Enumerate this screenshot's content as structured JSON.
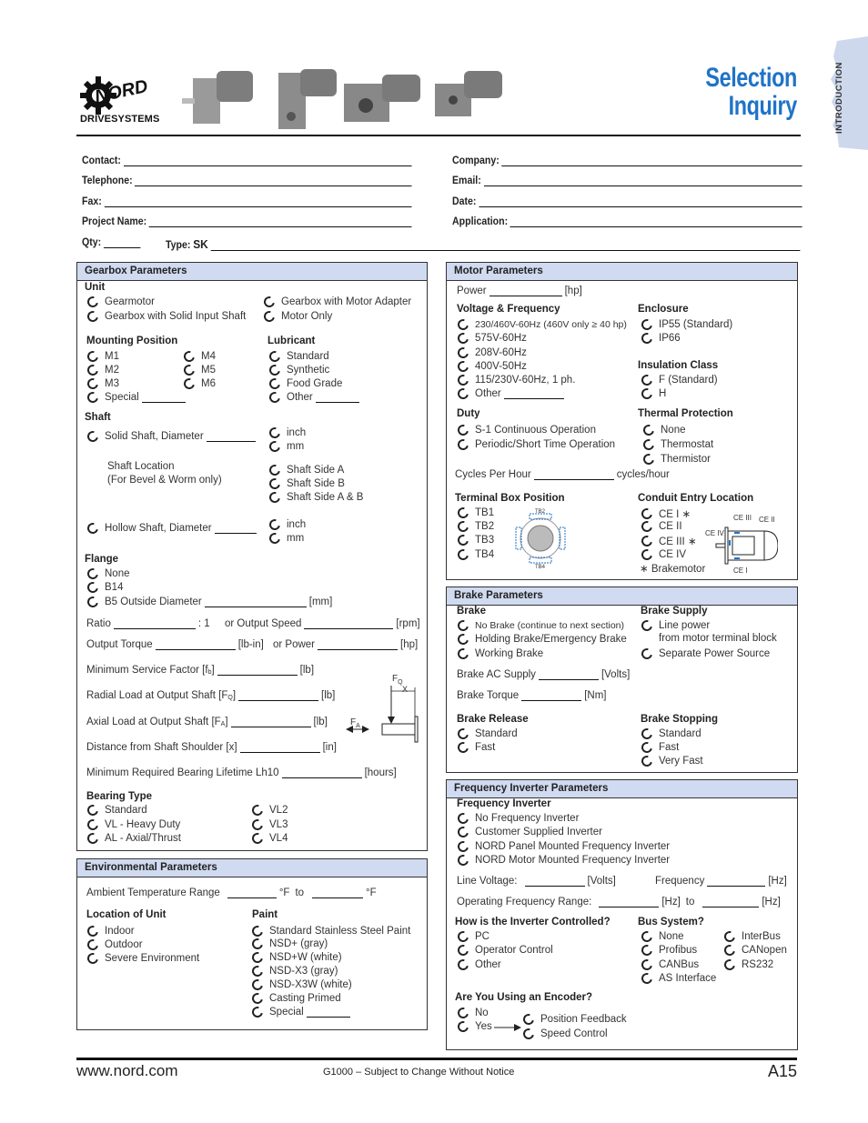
{
  "header": {
    "brand": "NORD",
    "brand_sub": "DRIVESYSTEMS",
    "title_line1": "Selection",
    "title_line2": "Inquiry",
    "section_tab": "INTRODUCTION",
    "brand_color": "#1f73c7",
    "panel_header_color": "#d0daf0"
  },
  "contact": {
    "contact": "Contact:",
    "company": "Company:",
    "telephone": "Telephone:",
    "email": "Email:",
    "fax": "Fax:",
    "date": "Date:",
    "project_name": "Project Name:",
    "application": "Application:",
    "qty": "Qty:",
    "type": "Type:",
    "type_prefix": "SK"
  },
  "gearbox": {
    "title": "Gearbox Parameters",
    "unit": {
      "label": "Unit",
      "options": [
        "Gearmotor",
        "Gearbox with Solid Input Shaft",
        "Gearbox with Motor Adapter",
        "Motor Only"
      ]
    },
    "mounting": {
      "label": "Mounting Position",
      "options": [
        "M1",
        "M2",
        "M3",
        "Special",
        "M4",
        "M5",
        "M6"
      ]
    },
    "lubricant": {
      "label": "Lubricant",
      "options": [
        "Standard",
        "Synthetic",
        "Food Grade",
        "Other"
      ]
    },
    "shaft": {
      "label": "Shaft",
      "solid": "Solid Shaft, Diameter",
      "units": [
        "inch",
        "mm"
      ],
      "location_label": "Shaft Location",
      "location_note": "(For Bevel & Worm only)",
      "location_options": [
        "Shaft Side A",
        "Shaft Side B",
        "Shaft Side A & B"
      ],
      "hollow": "Hollow Shaft, Diameter"
    },
    "flange": {
      "label": "Flange",
      "options": [
        "None",
        "B14",
        "B5 Outside Diameter"
      ],
      "unit": "[mm]"
    },
    "ratio": "Ratio",
    "ratio_suffix": ": 1",
    "output_speed": "or Output Speed",
    "rpm": "[rpm]",
    "output_torque": "Output Torque",
    "lbin": "[lb-in]",
    "or_power": "or Power",
    "hp": "[hp]",
    "service_factor": "Minimum Service Factor [f",
    "service_sub": "b",
    "lb": "[lb]",
    "radial_load": "Radial Load at Output Shaft [F",
    "radial_sub": "Q",
    "axial_load": "Axial Load at Output Shaft [F",
    "axial_sub": "A",
    "distance": "Distance from Shaft Shoulder [x]",
    "in": "[in]",
    "lifetime": "Minimum Required Bearing Lifetime Lh10",
    "hours": "[hours]",
    "diagram": {
      "fq": "F",
      "fq_sub": "Q",
      "x": "X",
      "fa": "F",
      "fa_sub": "A"
    },
    "bearing": {
      "label": "Bearing Type",
      "options": [
        "Standard",
        "VL - Heavy Duty",
        "AL - Axial/Thrust",
        "VL2",
        "VL3",
        "VL4"
      ]
    }
  },
  "environment": {
    "title": "Environmental Parameters",
    "ambient": "Ambient Temperature Range",
    "deg_f": "°F",
    "to": "to",
    "location": {
      "label": "Location of Unit",
      "options": [
        "Indoor",
        "Outdoor",
        "Severe Environment"
      ]
    },
    "paint": {
      "label": "Paint",
      "options": [
        "Standard Stainless Steel Paint",
        "NSD+ (gray)",
        "NSD+W (white)",
        "NSD-X3 (gray)",
        "NSD-X3W (white)",
        "Casting Primed",
        "Special"
      ]
    }
  },
  "motor": {
    "title": "Motor Parameters",
    "power": "Power",
    "hp": "[hp]",
    "voltage": {
      "label": "Voltage & Frequency",
      "options": [
        "230/460V-60Hz (460V only ≥ 40 hp)",
        "575V-60Hz",
        "208V-60Hz",
        "400V-50Hz",
        "115/230V-60Hz, 1 ph.",
        "Other"
      ]
    },
    "enclosure": {
      "label": "Enclosure",
      "options": [
        "IP55 (Standard)",
        "IP66"
      ]
    },
    "insulation": {
      "label": "Insulation Class",
      "options": [
        "F (Standard)",
        "H"
      ]
    },
    "duty": {
      "label": "Duty",
      "options": [
        "S-1 Continuous Operation",
        "Periodic/Short Time Operation"
      ]
    },
    "thermal": {
      "label": "Thermal Protection",
      "options": [
        "None",
        "Thermostat",
        "Thermistor"
      ]
    },
    "cycles": "Cycles Per Hour",
    "cycles_unit": "cycles/hour",
    "terminal": {
      "label": "Terminal Box Position",
      "options": [
        "TB1",
        "TB2",
        "TB3",
        "TB4"
      ]
    },
    "conduit": {
      "label": "Conduit Entry Location",
      "options": [
        "CE I ∗",
        "CE II",
        "CE III ∗",
        "CE IV"
      ],
      "note": "∗ Brakemotor",
      "diagram_labels": [
        "CE III",
        "CE II",
        "CE IV",
        "CE I"
      ]
    }
  },
  "brake": {
    "title": "Brake Parameters",
    "brake": {
      "label": "Brake",
      "options": [
        "No Brake (continue to next section)",
        "Holding Brake/Emergency Brake",
        "Working Brake"
      ]
    },
    "supply": {
      "label": "Brake Supply",
      "options": [
        "Line power",
        "Separate Power Source"
      ],
      "line_power_note": "from motor terminal block"
    },
    "ac_supply": "Brake AC Supply",
    "volts": "[Volts]",
    "torque": "Brake Torque",
    "nm": "[Nm]",
    "release": {
      "label": "Brake Release",
      "options": [
        "Standard",
        "Fast"
      ]
    },
    "stopping": {
      "label": "Brake Stopping",
      "options": [
        "Standard",
        "Fast",
        "Very Fast"
      ]
    }
  },
  "inverter": {
    "title": "Frequency Inverter Parameters",
    "inverter": {
      "label": "Frequency Inverter",
      "options": [
        "No Frequency Inverter",
        "Customer Supplied Inverter",
        "NORD Panel Mounted Frequency Inverter",
        "NORD Motor Mounted Frequency Inverter"
      ]
    },
    "line_voltage": "Line Voltage:",
    "volts": "[Volts]",
    "frequency": "Frequency",
    "hz": "[Hz]",
    "op_range": "Operating Frequency Range:",
    "to": "to",
    "control": {
      "label": "How is the Inverter Controlled?",
      "options": [
        "PC",
        "Operator Control",
        "Other"
      ]
    },
    "bus": {
      "label": "Bus System?",
      "options": [
        "None",
        "Profibus",
        "CANBus",
        "AS Interface",
        "InterBus",
        "CANopen",
        "RS232"
      ]
    },
    "encoder": {
      "label": "Are You Using an Encoder?",
      "options": [
        "No",
        "Yes"
      ],
      "yes_options": [
        "Position Feedback",
        "Speed Control"
      ]
    }
  },
  "footer": {
    "url": "www.nord.com",
    "notice": "G1000 – Subject to Change Without Notice",
    "page": "A15"
  }
}
